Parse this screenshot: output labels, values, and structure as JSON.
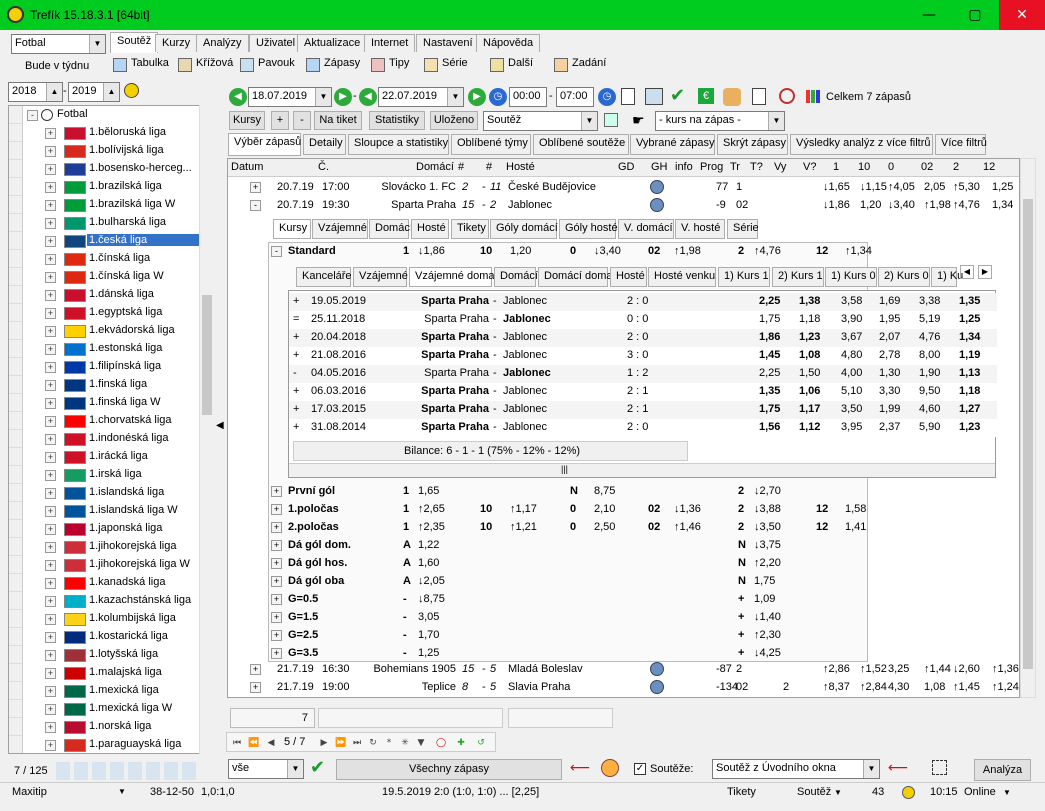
{
  "window": {
    "title": "Trefík 15.18.3.1 [64bit]"
  },
  "top": {
    "sport": "Fotbal",
    "week_label": "Bude v týdnu",
    "year_from": "2018",
    "year_to": "2019"
  },
  "menu_tabs": [
    "Soutěž",
    "Kurzy",
    "Analýzy",
    "Uživatel",
    "Aktualizace",
    "Internet",
    "Nastavení",
    "Nápověda"
  ],
  "toolbar": [
    "Tabulka",
    "Křížová",
    "Pavouk",
    "Zápasy",
    "Tipy",
    "Série",
    "Další",
    "Zadání"
  ],
  "filter": {
    "date_from": "18.07.2019",
    "date_to": "22.07.2019",
    "time_from": "00:00",
    "time_to": "07:00",
    "total": "Celkem 7 zápasů",
    "competition": "Soutěž",
    "odds_hint": "- kurs na zápas -"
  },
  "filter_buttons": [
    "Kursy",
    "+",
    "-",
    "Na tiket",
    "Statistiky",
    "Uloženo"
  ],
  "main_tabs": [
    "Výběr zápasů",
    "Detaily",
    "Sloupce a statistiky",
    "Oblíbené týmy",
    "Oblíbené soutěže",
    "Vybrané zápasy",
    "Skrýt zápasy",
    "Výsledky analýz z více filtrů",
    "Více filtrů"
  ],
  "col_headers": [
    "Datum",
    "Č.",
    "Domácí",
    "#",
    "#",
    "Hosté",
    "GD",
    "GH",
    "info",
    "Prog",
    "Tr",
    "T?",
    "Vy",
    "V?",
    "1",
    "10",
    "0",
    "02",
    "2",
    "12"
  ],
  "league_root": "Fotbal",
  "leagues": [
    "1.běloruská liga",
    "1.bolívijská liga",
    "1.bosensko-herceg...",
    "1.brazilská liga",
    "1.brazilská liga W",
    "1.bulharská liga",
    "1.česká liga",
    "1.čínská liga",
    "1.čínská liga W",
    "1.dánská liga",
    "1.egyptská liga",
    "1.ekvádorská liga",
    "1.estonská liga",
    "1.filipínská liga",
    "1.finská liga",
    "1.finská liga W",
    "1.chorvatská liga",
    "1.indonéská liga",
    "1.irácká liga",
    "1.irská liga",
    "1.islandská liga",
    "1.islandská liga W",
    "1.japonská liga",
    "1.jihokorejská liga",
    "1.jihokorejská liga W",
    "1.kanadská liga",
    "1.kazachstánská liga",
    "1.kolumbijská liga",
    "1.kostarická liga",
    "1.lotyšská liga",
    "1.malajská liga",
    "1.mexická liga",
    "1.mexická liga W",
    "1.norská liga",
    "1.paraguayská liga"
  ],
  "flag_colors": [
    "#c8102e",
    "#d52b1e",
    "#1f3c96",
    "#009c3b",
    "#009c3b",
    "#00966e",
    "#11457e",
    "#de2910",
    "#de2910",
    "#c8102e",
    "#ce1126",
    "#ffd100",
    "#0072ce",
    "#0038a8",
    "#003580",
    "#003580",
    "#ff0000",
    "#ce1126",
    "#ce1126",
    "#169b62",
    "#02529c",
    "#02529c",
    "#bc002d",
    "#cd2e3a",
    "#cd2e3a",
    "#ff0000",
    "#00afca",
    "#fcd116",
    "#002b7f",
    "#9e3039",
    "#cc0001",
    "#006847",
    "#006847",
    "#ba0c2f",
    "#d52b1e"
  ],
  "league_count": "7 / 125",
  "matches": [
    {
      "date": "20.7.19",
      "time": "17:00",
      "home": "Slovácko 1. FC",
      "h_rank": "2",
      "a_rank": "11",
      "away": "České Budějovice",
      "prog": "77",
      "tr": "1",
      "o1": "↓1,65",
      "o10": "↓1,15",
      "o0": "↑4,05",
      "o02": "2,05",
      "o2": "↑5,30",
      "o12": "1,25"
    },
    {
      "date": "20.7.19",
      "time": "19:30",
      "home": "Sparta Praha",
      "h_rank": "15",
      "a_rank": "2",
      "away": "Jablonec",
      "prog": "-9",
      "tr": "02",
      "o1": "↓1,86",
      "o10": "1,20",
      "o0": "↓3,40",
      "o02": "↑1,98",
      "o2": "↑4,76",
      "o12": "1,34"
    },
    {
      "date": "21.7.19",
      "time": "16:30",
      "home": "Bohemians 1905",
      "h_rank": "15",
      "a_rank": "5",
      "away": "Mladá Boleslav",
      "prog": "-87",
      "tr": "2",
      "o1": "↑2,86",
      "o10": "↑1,52",
      "o0": "3,25",
      "o02": "↑1,44",
      "o2": "↓2,60",
      "o12": "↑1,36"
    },
    {
      "date": "21.7.19",
      "time": "19:00",
      "home": "Teplice",
      "h_rank": "8",
      "a_rank": "5",
      "away": "Slavia Praha",
      "prog": "-134",
      "tr": "02",
      "vy": "2",
      "o1": "↑8,37",
      "o10": "↑2,84",
      "o0": "4,30",
      "o02": "1,08",
      "o2": "↑1,45",
      "o12": "↑1,24"
    }
  ],
  "detail_tabs": [
    "Kursy",
    "Vzájemné",
    "Domácí",
    "Hosté",
    "Tikety",
    "Góly domácí",
    "Góly hosté",
    "V. domácí",
    "V. hosté",
    "Série"
  ],
  "standard_row": {
    "label": "Standard",
    "a": "1",
    "b": "↓1,86",
    "c": "10",
    "d": "1,20",
    "e": "0",
    "f": "↓3,40",
    "g": "02",
    "h": "↑1,98",
    "i": "2",
    "j": "↑4,76",
    "k": "12",
    "l": "↑1,34"
  },
  "h2h_tabs": [
    "Kanceláře",
    "Vzájemné",
    "Vzájemné doma",
    "Domácí",
    "Domácí doma",
    "Hosté",
    "Hosté venku",
    "1) Kurs 1",
    "2) Kurs 1",
    "1) Kurs 0",
    "2) Kurs 0",
    "1) Ku"
  ],
  "h2h": [
    {
      "sign": "+",
      "date": "19.05.2019",
      "home": "Sparta Praha",
      "away": "Jablonec",
      "score": "2 : 0",
      "k1": "2,25",
      "k2": "1,38",
      "k3": "3,58",
      "k4": "1,69",
      "k5": "3,38",
      "k6": "1,35",
      "bold_home": true
    },
    {
      "sign": "=",
      "date": "25.11.2018",
      "home": "Sparta Praha",
      "away": "Jablonec",
      "score": "0 : 0",
      "k1": "1,75",
      "k2": "1,18",
      "k3": "3,90",
      "k4": "1,95",
      "k5": "5,19",
      "k6": "1,25",
      "bold_home": false
    },
    {
      "sign": "+",
      "date": "20.04.2018",
      "home": "Sparta Praha",
      "away": "Jablonec",
      "score": "2 : 0",
      "k1": "1,86",
      "k2": "1,23",
      "k3": "3,67",
      "k4": "2,07",
      "k5": "4,76",
      "k6": "1,34",
      "bold_home": true
    },
    {
      "sign": "+",
      "date": "21.08.2016",
      "home": "Sparta Praha",
      "away": "Jablonec",
      "score": "3 : 0",
      "k1": "1,45",
      "k2": "1,08",
      "k3": "4,80",
      "k4": "2,78",
      "k5": "8,00",
      "k6": "1,19",
      "bold_home": true
    },
    {
      "sign": "-",
      "date": "04.05.2016",
      "home": "Sparta Praha",
      "away": "Jablonec",
      "score": "1 : 2",
      "k1": "2,25",
      "k2": "1,50",
      "k3": "4,00",
      "k4": "1,30",
      "k5": "1,90",
      "k6": "1,13",
      "bold_home": false
    },
    {
      "sign": "+",
      "date": "06.03.2016",
      "home": "Sparta Praha",
      "away": "Jablonec",
      "score": "2 : 1",
      "k1": "1,35",
      "k2": "1,06",
      "k3": "5,10",
      "k4": "3,30",
      "k5": "9,50",
      "k6": "1,18",
      "bold_home": true
    },
    {
      "sign": "+",
      "date": "17.03.2015",
      "home": "Sparta Praha",
      "away": "Jablonec",
      "score": "2 : 1",
      "k1": "1,75",
      "k2": "1,17",
      "k3": "3,50",
      "k4": "1,99",
      "k5": "4,60",
      "k6": "1,27",
      "bold_home": true
    },
    {
      "sign": "+",
      "date": "31.08.2014",
      "home": "Sparta Praha",
      "away": "Jablonec",
      "score": "2 : 0",
      "k1": "1,56",
      "k2": "1,12",
      "k3": "3,95",
      "k4": "2,37",
      "k5": "5,90",
      "k6": "1,23",
      "bold_home": true
    }
  ],
  "h2h_balance": "Bilance: 6 - 1 - 1  (75% - 12% - 12%)",
  "bet_rows": [
    {
      "label": "První gól",
      "a": "1",
      "b": "1,65",
      "e": "N",
      "f": "8,75",
      "i": "2",
      "j": "↓2,70"
    },
    {
      "label": "1.poločas",
      "a": "1",
      "b": "↑2,65",
      "c": "10",
      "d": "↑1,17",
      "e": "0",
      "f": "2,10",
      "g": "02",
      "h": "↓1,36",
      "i": "2",
      "j": "↓3,88",
      "k": "12",
      "l": "1,58"
    },
    {
      "label": "2.poločas",
      "a": "1",
      "b": "↑2,35",
      "c": "10",
      "d": "↑1,21",
      "e": "0",
      "f": "2,50",
      "g": "02",
      "h": "↑1,46",
      "i": "2",
      "j": "↓3,50",
      "k": "12",
      "l": "1,41"
    },
    {
      "label": "Dá gól dom.",
      "a": "A",
      "b": "1,22",
      "i": "N",
      "j": "↓3,75"
    },
    {
      "label": "Dá gól hos.",
      "a": "A",
      "b": "1,60",
      "i": "N",
      "j": "↑2,20"
    },
    {
      "label": "Dá gól oba",
      "a": "A",
      "b": "↓2,05",
      "i": "N",
      "j": "1,75"
    },
    {
      "label": "G=0.5",
      "a": "-",
      "b": "↓8,75",
      "i": "+",
      "j": "1,09"
    },
    {
      "label": "G=1.5",
      "a": "-",
      "b": "3,05",
      "i": "+",
      "j": "↓1,40"
    },
    {
      "label": "G=2.5",
      "a": "-",
      "b": "1,70",
      "i": "+",
      "j": "↑2,30"
    },
    {
      "label": "G=3.5",
      "a": "-",
      "b": "1,25",
      "i": "+",
      "j": "↓4,25"
    }
  ],
  "grid_footer_count": "7",
  "pager": "5 / 7",
  "bottom": {
    "filter_value": "vše",
    "all_matches": "Všechny zápasy",
    "competitions_label": "Soutěže:",
    "competition_source": "Soutěž z Úvodního okna",
    "analyze": "Analýza"
  },
  "status": {
    "left": "Maxitip",
    "score_a": "38-12-50",
    "score_b": "1,0:1,0",
    "center": "19.5.2019 2:0 (1:0, 1:0) ... [2,25]",
    "tikety": "Tikety",
    "soutez": "Soutěž",
    "count": "43",
    "time": "10:15",
    "online": "Online"
  }
}
